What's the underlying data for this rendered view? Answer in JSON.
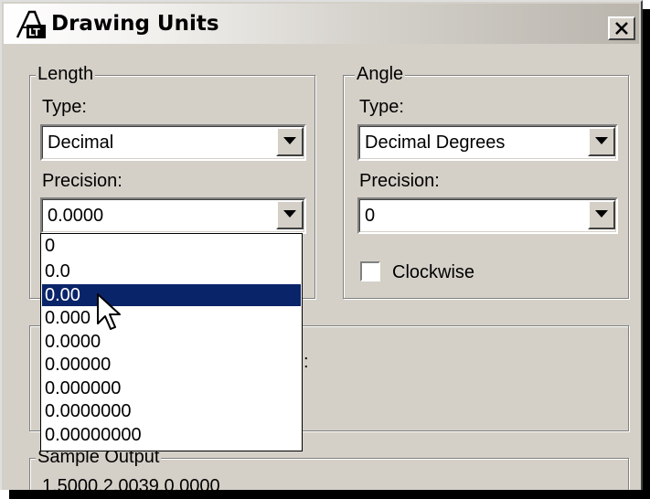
{
  "window": {
    "title": "Drawing Units"
  },
  "length": {
    "group_label": "Length",
    "type_label": "Type:",
    "type_value": "Decimal",
    "precision_label": "Precision:",
    "precision_value": "0.0000",
    "precision_options": [
      "0",
      "0.0",
      "0.00",
      "0.000",
      "0.0000",
      "0.00000",
      "0.000000",
      "0.0000000",
      "0.00000000"
    ],
    "highlighted_option": "0.00"
  },
  "angle": {
    "group_label": "Angle",
    "type_label": "Type:",
    "type_value": "Decimal Degrees",
    "precision_label": "Precision:",
    "precision_value": "0",
    "clockwise_label": "Clockwise",
    "clockwise_checked": false
  },
  "insertion_scale": {
    "partial_text": ":"
  },
  "sample_output": {
    "group_label": "Sample Output",
    "line1": "1.5000,2.0039,0.0000"
  },
  "icons": {
    "app": "autocad-lt-icon",
    "close": "close-x-icon",
    "dropdown": "chevron-down-icon",
    "cursor": "mouse-pointer-icon"
  },
  "colors": {
    "face": "#d4d0c8",
    "selection": "#0a246a",
    "selection_text": "#ffffff"
  }
}
